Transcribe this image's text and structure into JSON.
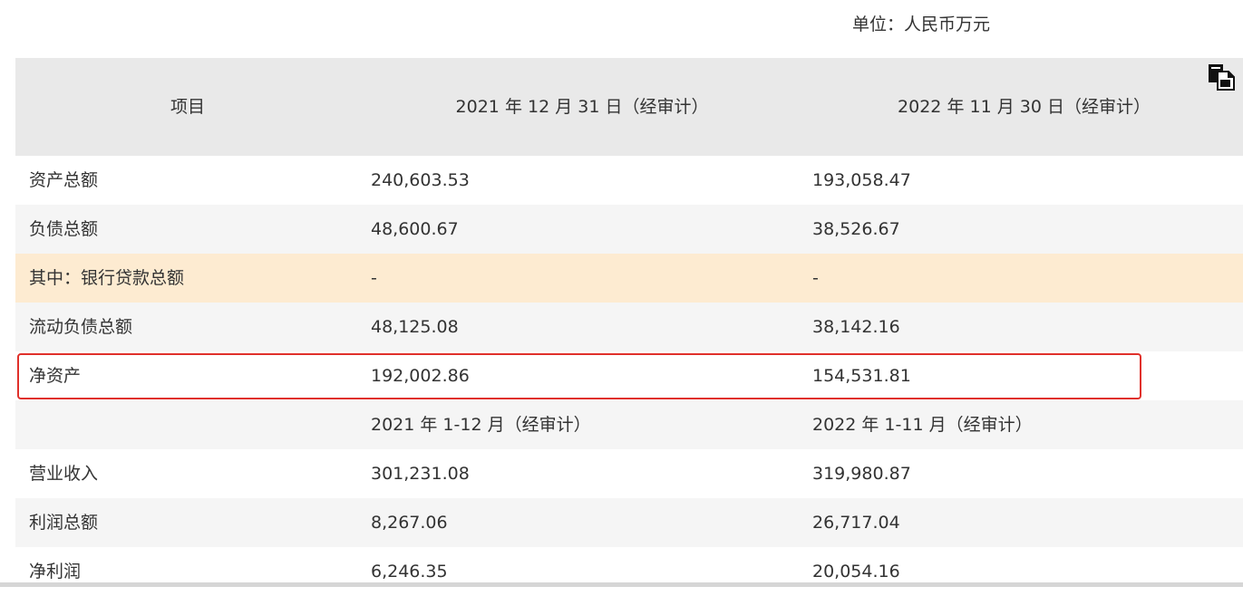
{
  "unit_label": "单位：人民币万元",
  "copy_icon": "copy-icon",
  "header": {
    "col0": "项目",
    "col1": "2021 年 12 月 31 日（经审计）",
    "col2": "2022 年 11 月 30 日（经审计）"
  },
  "rows": [
    {
      "label": "资产总额",
      "v1": "240,603.53",
      "v2": "193,058.47"
    },
    {
      "label": "负债总额",
      "v1": "48,600.67",
      "v2": "38,526.67"
    },
    {
      "label": "其中：银行贷款总额",
      "v1": "-",
      "v2": "-"
    },
    {
      "label": "流动负债总额",
      "v1": "48,125.08",
      "v2": "38,142.16"
    },
    {
      "label": "净资产",
      "v1": "192,002.86",
      "v2": "154,531.81"
    },
    {
      "label": "",
      "v1": "2021 年 1-12 月（经审计）",
      "v2": "2022 年 1-11 月（经审计）"
    },
    {
      "label": "营业收入",
      "v1": "301,231.08",
      "v2": "319,980.87"
    },
    {
      "label": "利润总额",
      "v1": "8,267.06",
      "v2": "26,717.04"
    },
    {
      "label": "净利润",
      "v1": "6,246.35",
      "v2": "20,054.16"
    }
  ]
}
